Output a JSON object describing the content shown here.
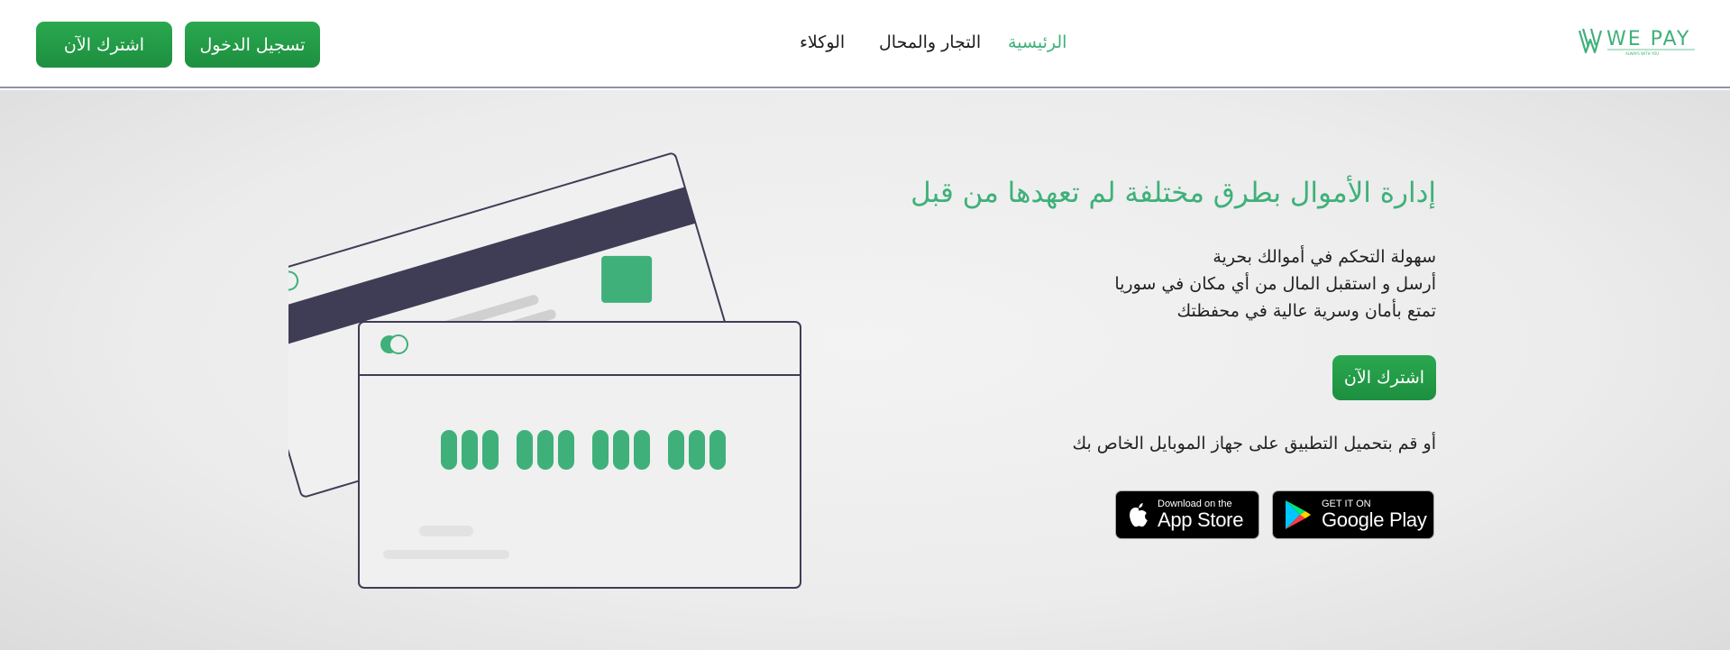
{
  "header": {
    "subscribe_label": "اشترك الآن",
    "login_label": "تسجيل الدخول",
    "nav": [
      {
        "label": "الرئيسية",
        "active": true
      },
      {
        "label": "التجار والمحال",
        "active": false
      },
      {
        "label": "الوكلاء",
        "active": false
      }
    ],
    "logo": {
      "text": "WE PAY",
      "tagline": "ALWAYS WITH YOU"
    }
  },
  "hero": {
    "title": "إدارة الأموال بطرق مختلفة لم تعهدها من قبل",
    "features": [
      "سهولة التحكم في أموالك بحرية",
      "أرسل و استقبل المال من أي مكان في سوريا",
      "تمتع بأمان وسرية عالية في محفظتك"
    ],
    "subscribe_label": "اشترك الآن",
    "download_text": "أو قم بتحميل التطبيق على جهاز الموبايل الخاص بك"
  },
  "stores": {
    "google": {
      "small": "GET IT ON",
      "big": "Google Play",
      "icon": "google-play-icon"
    },
    "apple": {
      "small": "Download on the",
      "big": "App Store",
      "icon": "apple-icon"
    }
  },
  "colors": {
    "accent": "#3fb07a",
    "button": "#259a47",
    "card_stroke": "#3f3d56",
    "background": "#ececec"
  }
}
